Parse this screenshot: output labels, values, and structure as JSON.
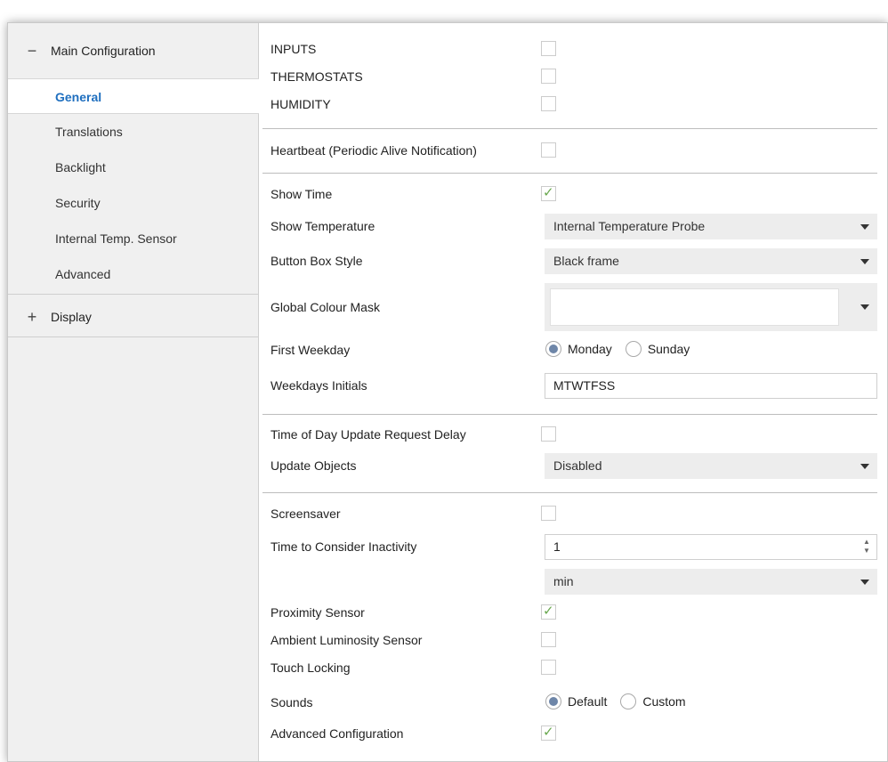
{
  "sidebar": {
    "groups": [
      {
        "toggle": "−",
        "label": "Main Configuration"
      },
      {
        "toggle": "+",
        "label": "Display"
      }
    ],
    "items": [
      {
        "label": "General",
        "active": true
      },
      {
        "label": "Translations"
      },
      {
        "label": "Backlight"
      },
      {
        "label": "Security"
      },
      {
        "label": "Internal Temp. Sensor"
      },
      {
        "label": "Advanced"
      }
    ]
  },
  "form": {
    "inputs": {
      "label": "INPUTS",
      "checked": false
    },
    "thermostats": {
      "label": "THERMOSTATS",
      "checked": false
    },
    "humidity": {
      "label": "HUMIDITY",
      "checked": false
    },
    "heartbeat": {
      "label": "Heartbeat (Periodic Alive Notification)",
      "checked": false
    },
    "show_time": {
      "label": "Show Time",
      "checked": true,
      "tick": "✓"
    },
    "show_temperature": {
      "label": "Show Temperature",
      "value": "Internal Temperature Probe"
    },
    "button_box_style": {
      "label": "Button Box Style",
      "value": "Black frame"
    },
    "global_colour_mask": {
      "label": "Global Colour Mask",
      "value": ""
    },
    "first_weekday": {
      "label": "First Weekday",
      "options": [
        "Monday",
        "Sunday"
      ],
      "selected": "Monday"
    },
    "weekdays_initials": {
      "label": "Weekdays Initials",
      "value": "MTWTFSS"
    },
    "tod_update_delay": {
      "label": "Time of Day Update Request Delay",
      "checked": false
    },
    "update_objects": {
      "label": "Update Objects",
      "value": "Disabled"
    },
    "screensaver": {
      "label": "Screensaver",
      "checked": false
    },
    "inactivity": {
      "label": "Time to Consider Inactivity",
      "value": "1",
      "spin_up": "▲",
      "spin_down": "▼",
      "unit": "min"
    },
    "proximity_sensor": {
      "label": "Proximity Sensor",
      "checked": true,
      "tick": "✓"
    },
    "ambient_luminosity": {
      "label": "Ambient Luminosity Sensor",
      "checked": false
    },
    "touch_locking": {
      "label": "Touch Locking",
      "checked": false
    },
    "sounds": {
      "label": "Sounds",
      "options": [
        "Default",
        "Custom"
      ],
      "selected": "Default"
    },
    "advanced_configuration": {
      "label": "Advanced Configuration",
      "checked": true,
      "tick": "✓"
    }
  },
  "colors": {
    "accent": "#1f6fbf",
    "check": "#6aa84f",
    "sidebar_bg": "#f0f0f0",
    "dropdown_bg": "#ededed",
    "radio_dot": "#6e86a8"
  }
}
